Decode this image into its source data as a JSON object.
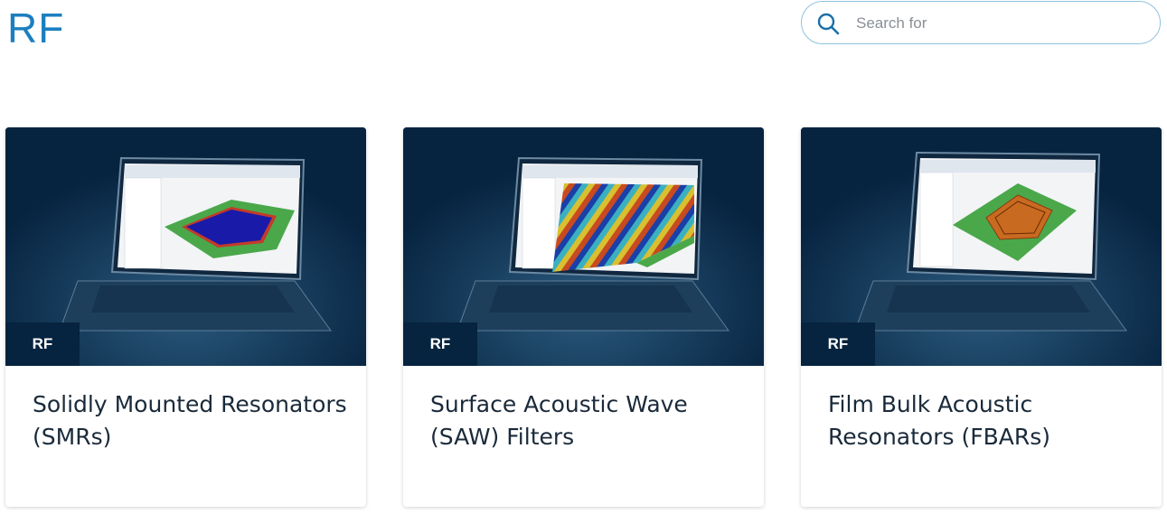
{
  "header": {
    "title": "RF",
    "search_placeholder": "Search for"
  },
  "icons": {
    "search": "search-icon"
  },
  "colors": {
    "accent": "#1b7fbf",
    "card_image_bg": "#06233f",
    "search_border": "#8fc3df"
  },
  "cards": [
    {
      "tag": "RF",
      "title": "Solidly Mounted Resonators (SMRs)"
    },
    {
      "tag": "RF",
      "title": "Surface Acoustic Wave (SAW) Filters"
    },
    {
      "tag": "RF",
      "title": "Film Bulk Acoustic Resonators (FBARs)"
    }
  ]
}
